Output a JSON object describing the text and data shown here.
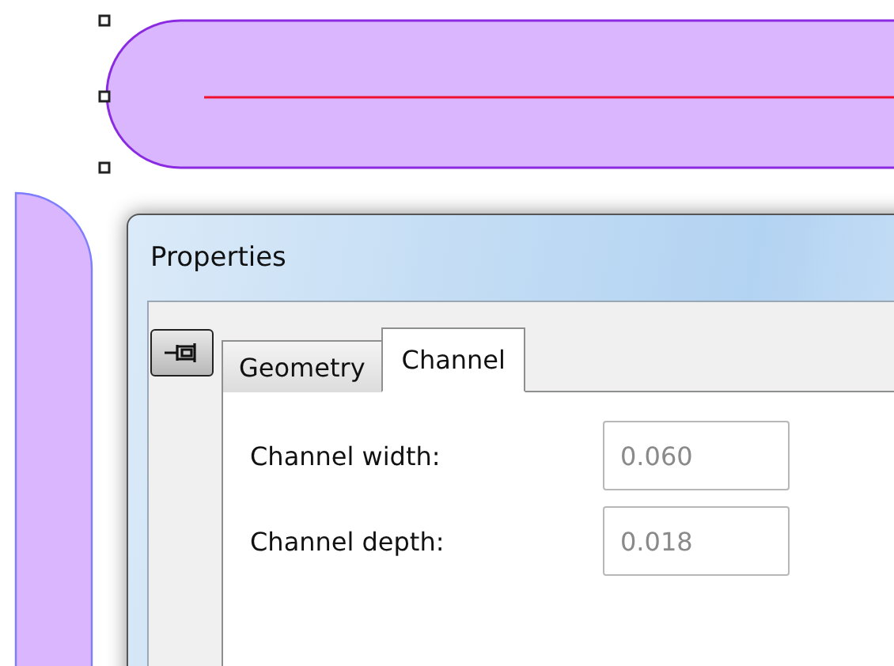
{
  "dialog": {
    "title": "Properties",
    "tabs": [
      {
        "label": "Geometry",
        "selected": false
      },
      {
        "label": "Channel",
        "selected": true
      }
    ],
    "fields": [
      {
        "label": "Channel width:",
        "value": "0.060",
        "disabled": true
      },
      {
        "label": "Channel depth:",
        "value": "0.018",
        "disabled": true
      }
    ]
  }
}
